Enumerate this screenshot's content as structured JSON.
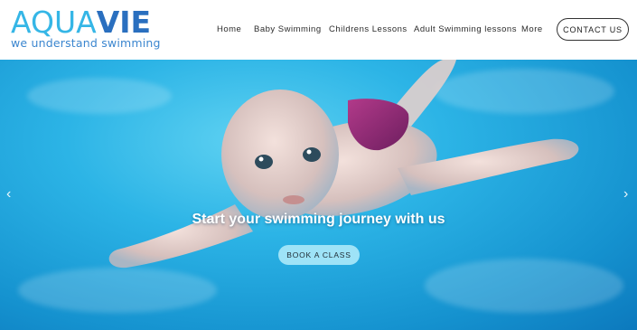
{
  "brand": {
    "logo_part1": "AQUA",
    "logo_part2": "VIE",
    "tagline": "we understand swimming",
    "colors": {
      "aqua": "#35b6e6",
      "vie": "#2a6fbf"
    }
  },
  "nav": {
    "items": [
      {
        "label": "Home"
      },
      {
        "label": "Baby Swimming"
      },
      {
        "label": "Childrens Lessons"
      },
      {
        "label": "Adult Swimming lessons"
      },
      {
        "label": "More"
      }
    ],
    "contact_label": "CONTACT US"
  },
  "hero": {
    "title": "Start your swimming journey with us",
    "cta_label": "BOOK A CLASS",
    "prev_icon": "chevron-left-icon",
    "next_icon": "chevron-right-icon",
    "prev_glyph": "‹",
    "next_glyph": "›",
    "colors": {
      "water": "#2cb4e6",
      "button": "#9ee3f7"
    }
  }
}
